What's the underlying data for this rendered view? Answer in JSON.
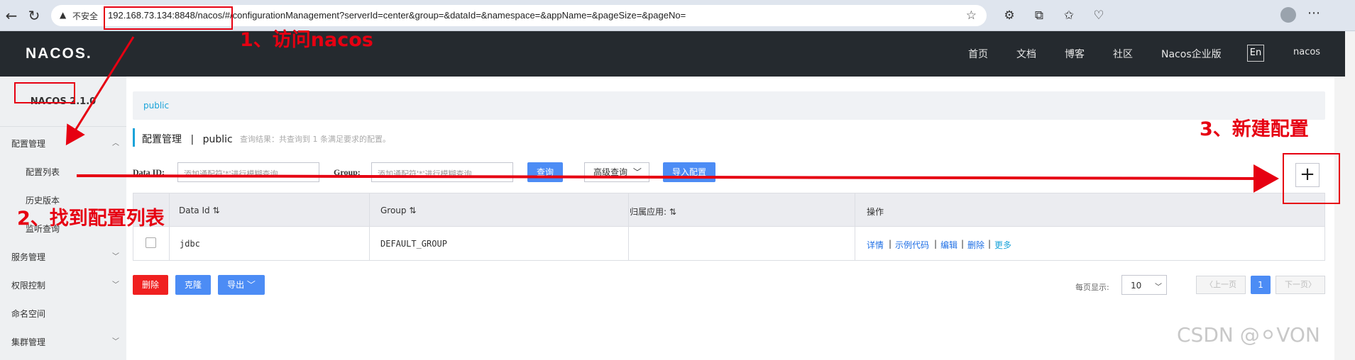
{
  "browser": {
    "security_label": "不安全",
    "url": "192.168.73.134:8848/nacos/#/configurationManagement?serverId=center&group=&dataId=&namespace=&appName=&pageSize=&pageNo="
  },
  "header": {
    "logo": "NACOS.",
    "nav": [
      "首页",
      "文档",
      "博客",
      "社区",
      "Nacos企业版"
    ],
    "lang": "En",
    "user": "nacos"
  },
  "sidebar": {
    "version": "NACOS 2.1.0",
    "items": [
      {
        "label": "配置管理"
      },
      {
        "label": "配置列表"
      },
      {
        "label": "历史版本"
      },
      {
        "label": "监听查询"
      },
      {
        "label": "服务管理"
      },
      {
        "label": "权限控制"
      },
      {
        "label": "命名空间"
      },
      {
        "label": "集群管理"
      }
    ]
  },
  "main": {
    "namespace_tab": "public",
    "title": "配置管理",
    "title_sep": "|",
    "title_ns": "public",
    "hint": "查询结果：共查询到 1 条满足要求的配置。",
    "filters": {
      "dataid_label": "Data ID:",
      "dataid_placeholder": "添加通配符'*'进行模糊查询",
      "group_label": "Group:",
      "group_placeholder": "添加通配符'*'进行模糊查询",
      "query_button": "查询",
      "advanced_button": "高级查询",
      "import_button": "导入配置"
    },
    "add_button": "+",
    "table": {
      "headers": [
        "Data Id",
        "Group",
        "归属应用:",
        "操作"
      ],
      "rows": [
        {
          "data_id": "jdbc",
          "group": "DEFAULT_GROUP",
          "app": "",
          "ops": [
            "详情",
            "示例代码",
            "编辑",
            "删除",
            "更多"
          ]
        }
      ]
    },
    "actions": {
      "delete": "删除",
      "clone": "克隆",
      "export": "导出"
    },
    "pager": {
      "per_page_label": "每页显示:",
      "per_page": "10",
      "prev": "上一页",
      "current": "1",
      "next": "下一页"
    }
  },
  "annotations": {
    "step1": "1、访问nacos",
    "step2": "2、找到配置列表",
    "step3": "3、新建配置"
  },
  "watermark": "CSDN @⚪VON"
}
